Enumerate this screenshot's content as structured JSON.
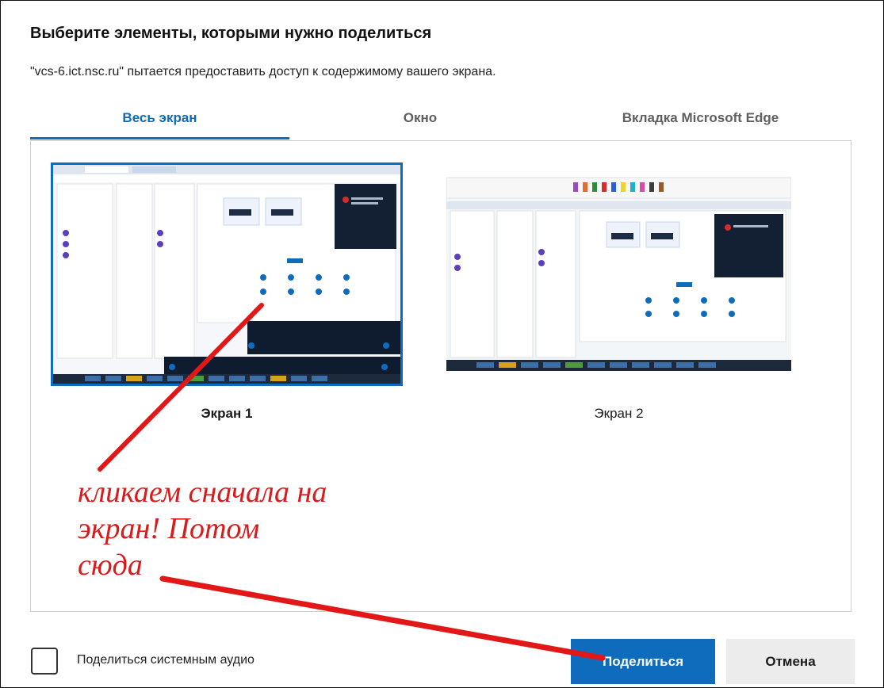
{
  "dialog": {
    "title": "Выберите элементы, которыми нужно поделиться",
    "subtitle": "\"vcs-6.ict.nsc.ru\" пытается предоставить доступ к содержимому вашего экрана."
  },
  "tabs": [
    {
      "label": "Весь экран",
      "active": true
    },
    {
      "label": "Окно",
      "active": false
    },
    {
      "label": "Вкладка Microsoft Edge",
      "active": false
    }
  ],
  "screens": [
    {
      "label": "Экран 1",
      "selected": true
    },
    {
      "label": "Экран 2",
      "selected": false
    }
  ],
  "footer": {
    "audio_checkbox_label": "Поделиться системным аудио",
    "audio_checked": false,
    "share_label": "Поделиться",
    "cancel_label": "Отмена"
  },
  "annotation": {
    "text": "кликаем сначала на\nэкран! Потом\nсюда",
    "color": "#d81c1c"
  },
  "colors": {
    "accent": "#0f6cbd",
    "annotation_red": "#d81c1c"
  }
}
